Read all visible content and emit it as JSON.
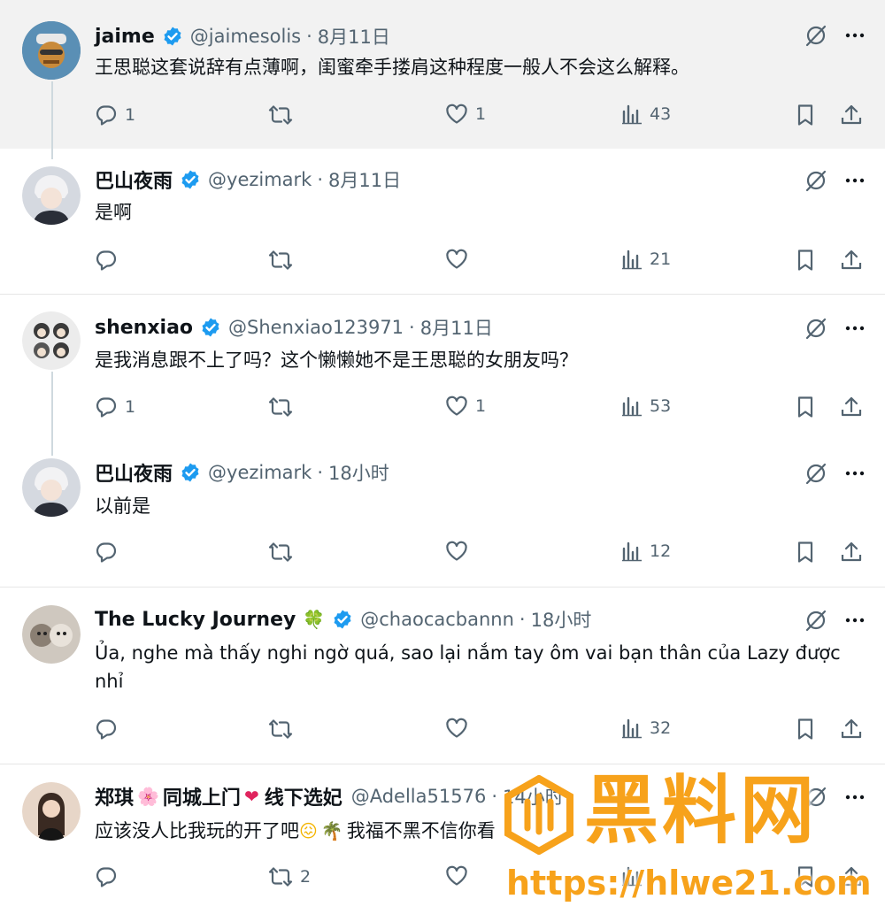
{
  "tweets": [
    {
      "name": "jaime",
      "handle": "@jaimesolis",
      "time": "8月11日",
      "text": "王思聪这套说辞有点薄啊，闺蜜牵手搂肩这种程度一般人不会这么解释。",
      "replies": "1",
      "retweets": "",
      "likes": "1",
      "views": "43"
    },
    {
      "name": "巴山夜雨",
      "handle": "@yezimark",
      "time": "8月11日",
      "text": "是啊",
      "replies": "",
      "retweets": "",
      "likes": "",
      "views": "21"
    },
    {
      "name": "shenxiao",
      "handle": "@Shenxiao123971",
      "time": "8月11日",
      "text": "是我消息跟不上了吗？这个懒懒她不是王思聪的女朋友吗？",
      "replies": "1",
      "retweets": "",
      "likes": "1",
      "views": "53"
    },
    {
      "name": "巴山夜雨",
      "handle": "@yezimark",
      "time": "18小时",
      "text": "以前是",
      "replies": "",
      "retweets": "",
      "likes": "",
      "views": "12"
    },
    {
      "name": "The Lucky Journey",
      "name_emoji": "🍀",
      "handle": "@chaocacbannn",
      "time": "18小时",
      "text": "Ủa, nghe mà thấy nghi ngờ quá, sao lại nắm tay ôm vai bạn thân của Lazy được nhỉ",
      "replies": "",
      "retweets": "",
      "likes": "",
      "views": "32"
    },
    {
      "name_part1": "郑琪",
      "name_part2": "同城上门",
      "name_part3": "线下选妃",
      "handle": "@Adella51576",
      "time": "14小时",
      "text_part1": "应该没人比我玩的开了吧",
      "text_part2": "我福不黑不信你看",
      "replies": "",
      "retweets": "2",
      "likes": "",
      "views": ""
    }
  ],
  "watermark": {
    "title": "黑料网",
    "url": "https://hlwe21.com"
  },
  "colors": {
    "verified": "#1d9bf0",
    "text": "#0f1419",
    "muted": "#536471",
    "watermark": "#f7a21b"
  }
}
